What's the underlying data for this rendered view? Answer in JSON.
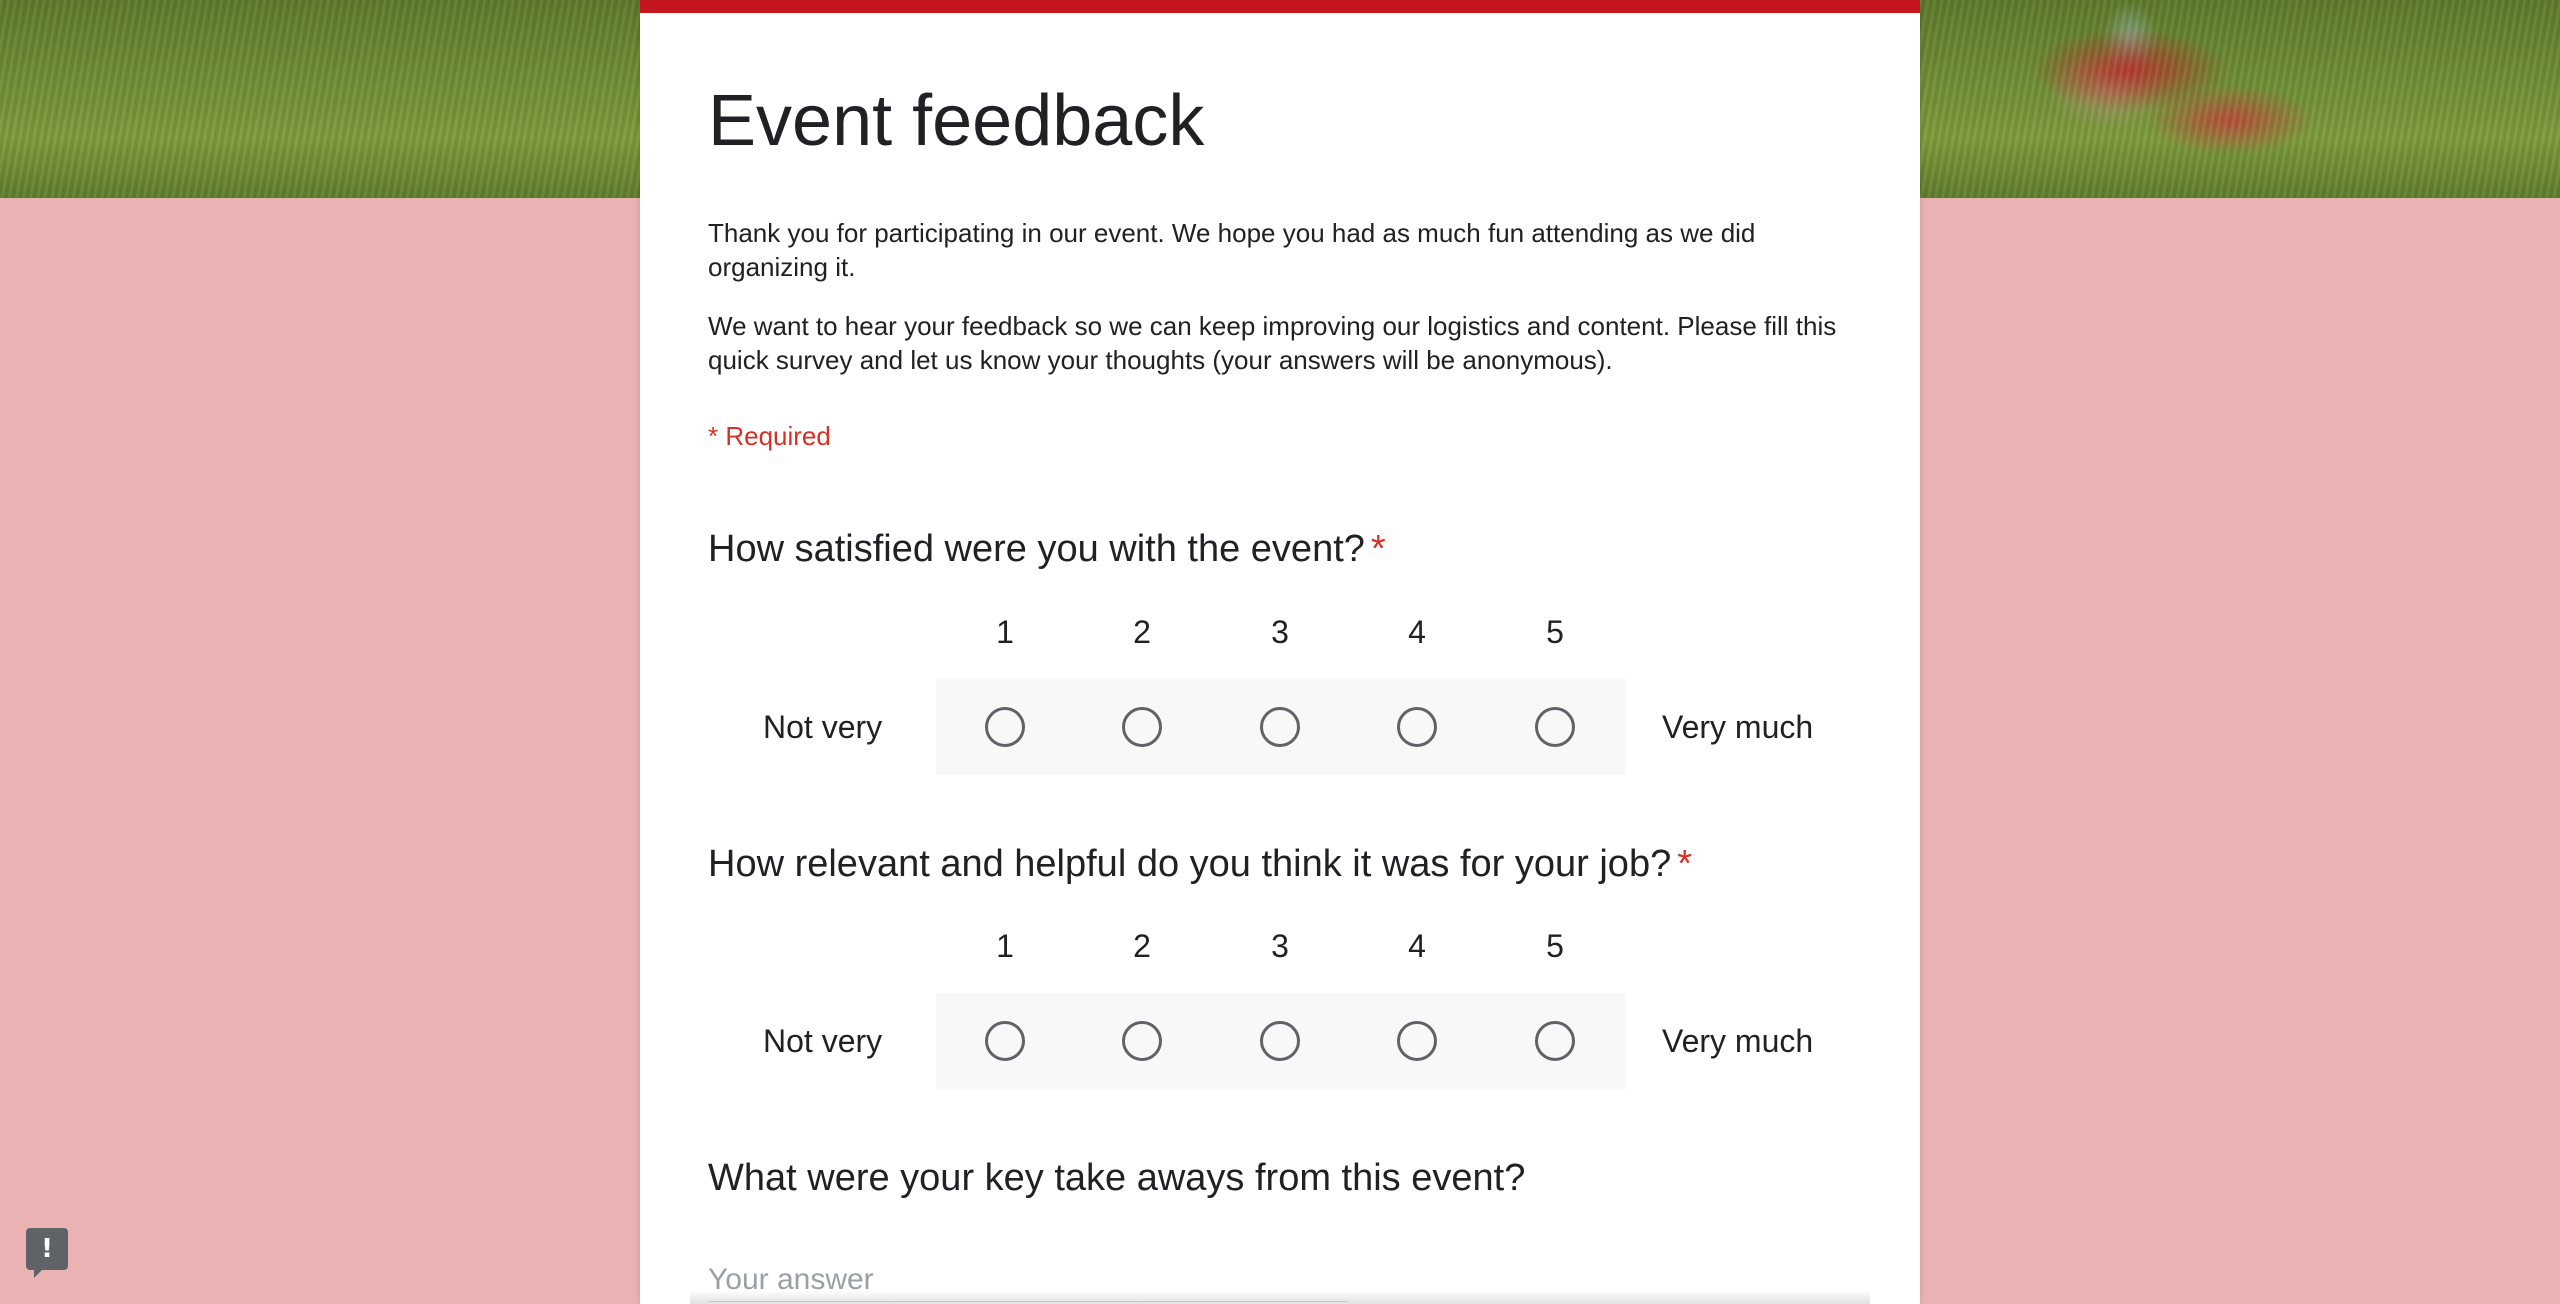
{
  "form": {
    "title": "Event feedback",
    "description_p1": "Thank you for participating in our event. We hope you had as much fun attending as we did organizing it.",
    "description_p2": "We want to hear your feedback so we can keep improving our logistics and content. Please fill this quick survey and let us know your thoughts (your answers will be anonymous).",
    "required_note": "* Required",
    "accent_color": "#c5161d",
    "background_color": "#e9b3b3"
  },
  "questions": [
    {
      "title": "How satisfied were you with the event?",
      "required_marker": "*",
      "scale": [
        "1",
        "2",
        "3",
        "4",
        "5"
      ],
      "low_label": "Not very",
      "high_label": "Very much"
    },
    {
      "title": "How relevant and helpful do you think it was for your job?",
      "required_marker": "*",
      "scale": [
        "1",
        "2",
        "3",
        "4",
        "5"
      ],
      "low_label": "Not very",
      "high_label": "Very much"
    },
    {
      "title": "What were your key take aways from this event?",
      "placeholder": "Your answer"
    }
  ],
  "report_button": {
    "icon": "report-icon",
    "glyph": "!"
  }
}
